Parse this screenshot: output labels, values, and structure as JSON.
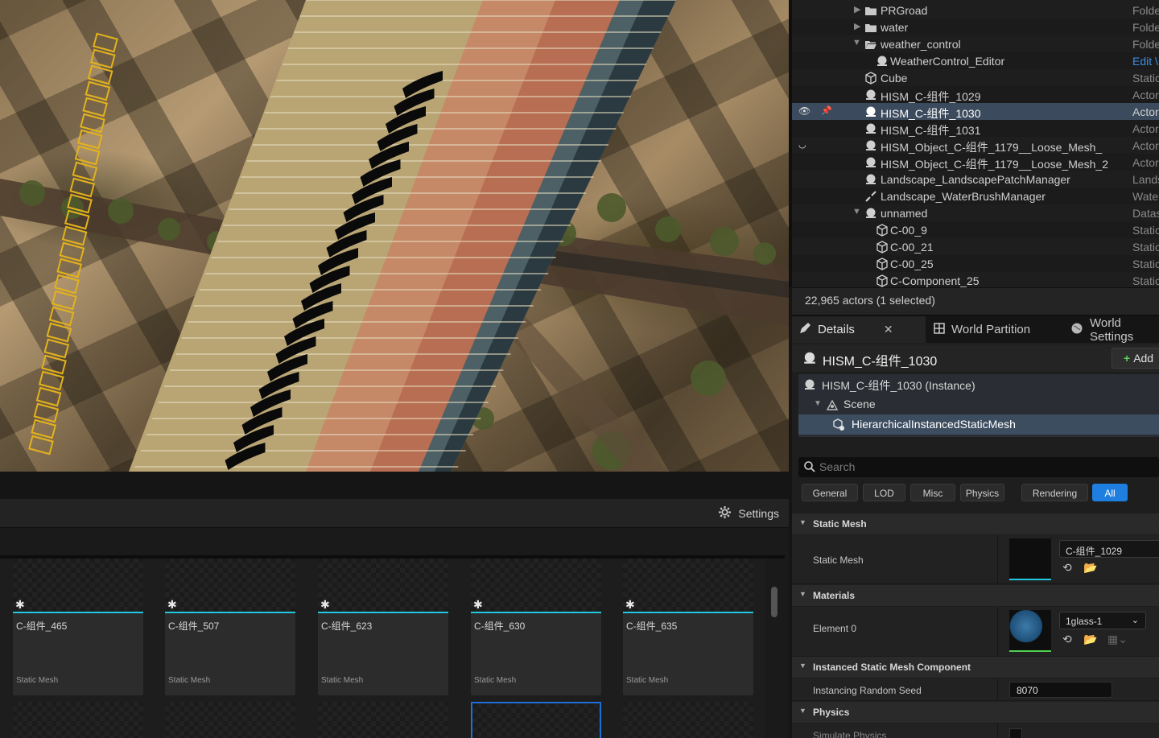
{
  "content_browser": {
    "settings_label": "Settings",
    "assets": [
      {
        "name": "C-组件_465",
        "type": "Static Mesh"
      },
      {
        "name": "C-组件_507",
        "type": "Static Mesh"
      },
      {
        "name": "C-组件_623",
        "type": "Static Mesh"
      },
      {
        "name": "C-组件_630",
        "type": "Static Mesh"
      },
      {
        "name": "C-组件_635",
        "type": "Static Mesh"
      }
    ]
  },
  "outliner": {
    "rows": [
      {
        "label": "PRGroad",
        "type": "Folde",
        "icon": "folder-icon"
      },
      {
        "label": "water",
        "type": "Folde",
        "icon": "folder-icon"
      },
      {
        "label": "weather_control",
        "type": "Folde",
        "icon": "folder-open-icon"
      },
      {
        "label": "WeatherControl_Editor",
        "type": "Edit \\",
        "icon": "actor-icon"
      },
      {
        "label": "Cube",
        "type": "Static",
        "icon": "static-mesh-icon"
      },
      {
        "label": "HISM_C-组件_1029",
        "type": "Actor",
        "icon": "actor-icon"
      },
      {
        "label": "HISM_C-组件_1030",
        "type": "Actor",
        "icon": "actor-icon"
      },
      {
        "label": "HISM_C-组件_1031",
        "type": "Actor",
        "icon": "actor-icon"
      },
      {
        "label": "HISM_Object_C-组件_1179__Loose_Mesh_",
        "type": "Actor",
        "icon": "actor-icon"
      },
      {
        "label": "HISM_Object_C-组件_1179__Loose_Mesh_2",
        "type": "Actor",
        "icon": "actor-icon"
      },
      {
        "label": "Landscape_LandscapePatchManager",
        "type": "Lands",
        "icon": "actor-icon"
      },
      {
        "label": "Landscape_WaterBrushManager",
        "type": "Wate",
        "icon": "brush-icon"
      },
      {
        "label": "unnamed",
        "type": "Datas",
        "icon": "actor-icon"
      },
      {
        "label": "C-00_9",
        "type": "Static",
        "icon": "static-mesh-icon"
      },
      {
        "label": "C-00_21",
        "type": "Static",
        "icon": "static-mesh-icon"
      },
      {
        "label": "C-00_25",
        "type": "Static",
        "icon": "static-mesh-icon"
      },
      {
        "label": "C-Component_25",
        "type": "Static",
        "icon": "static-mesh-icon"
      }
    ],
    "status": "22,965 actors (1 selected)"
  },
  "details": {
    "tabs": {
      "details": "Details",
      "world_partition": "World Partition",
      "world_settings": "World Settings"
    },
    "object_name": "HISM_C-组件_1030",
    "add_label": "Add",
    "components": {
      "instance": "HISM_C-组件_1030 (Instance)",
      "scene": "Scene",
      "hism": "HierarchicalInstancedStaticMesh"
    },
    "search_placeholder": "Search",
    "filters": [
      "General",
      "LOD",
      "Misc",
      "Physics",
      "Rendering",
      "All"
    ],
    "categories": {
      "static_mesh": "Static Mesh",
      "materials": "Materials",
      "ism": "Instanced Static Mesh Component",
      "physics": "Physics"
    },
    "props": {
      "static_mesh_label": "Static Mesh",
      "static_mesh_value": "C-组件_1029",
      "element0_label": "Element 0",
      "element0_value": "1glass-1",
      "seed_label": "Instancing Random Seed",
      "seed_value": "8070",
      "simulate_label": "Simulate Physics"
    }
  },
  "colors": {
    "accent_blue": "#1f7fe0",
    "thumb_bar": "#20c9e0",
    "selection": "#3b4a5c"
  }
}
